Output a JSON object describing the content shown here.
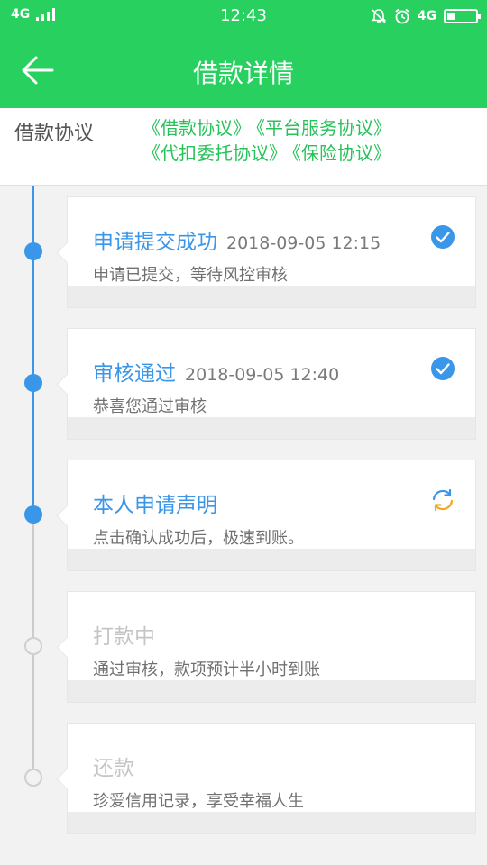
{
  "status_bar": {
    "network_left": "4G",
    "time": "12:43",
    "network_right": "4G"
  },
  "header": {
    "title": "借款详情"
  },
  "agreements": {
    "label": "借款协议",
    "links": [
      "《借款协议》",
      "《平台服务协议》",
      "《代扣委托协议》",
      "《保险协议》"
    ]
  },
  "timeline": [
    {
      "title": "申请提交成功",
      "date": "2018-09-05 12:15",
      "desc": "申请已提交，等待风控审核",
      "status": "done",
      "icon": "check-circle-icon"
    },
    {
      "title": "审核通过",
      "date": "2018-09-05 12:40",
      "desc": "恭喜您通过审核",
      "status": "done",
      "icon": "check-circle-icon"
    },
    {
      "title": "本人申请声明",
      "date": "",
      "desc": "点击确认成功后，极速到账。",
      "status": "in-progress",
      "icon": "refresh-icon"
    },
    {
      "title": "打款中",
      "date": "",
      "desc": "通过审核，款项预计半小时到账",
      "status": "pending",
      "icon": ""
    },
    {
      "title": "还款",
      "date": "",
      "desc": "珍爱信用记录，享受幸福人生",
      "status": "pending",
      "icon": ""
    }
  ],
  "colors": {
    "brand_green": "#27d05f",
    "link_green": "#27c25a",
    "accent_blue": "#3a96e8",
    "refresh_orange": "#f5a623"
  }
}
